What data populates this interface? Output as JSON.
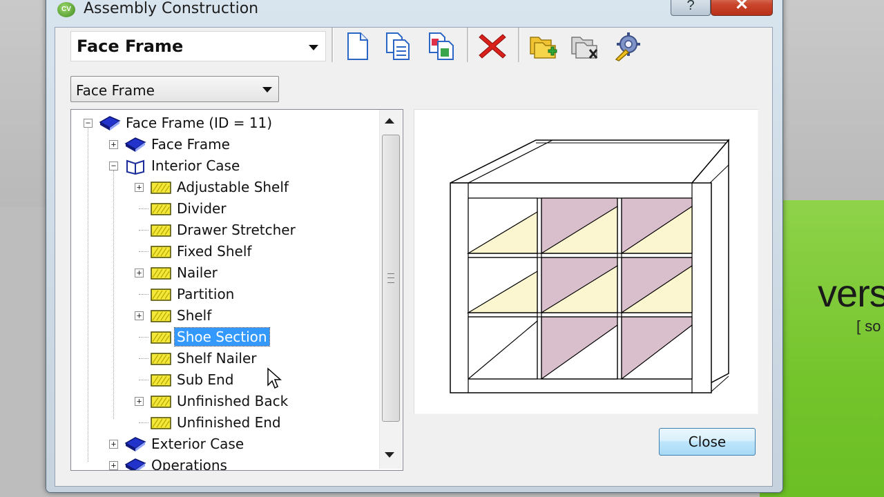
{
  "window": {
    "title": "Assembly Construction",
    "help_glyph": "?",
    "close_glyph": "✕"
  },
  "toolbar": {
    "assembly_combo_value": "Face Frame",
    "icons": [
      "new-page-icon",
      "copy-icon",
      "copy-special-icon",
      "delete-icon",
      "add-folder-icon",
      "remove-folder-icon",
      "settings-gear-icon"
    ]
  },
  "category_combo": {
    "value": "Face Frame"
  },
  "tree": {
    "items": [
      {
        "label": "Face Frame (ID = 11)",
        "icon": "book-icon",
        "expander": "−"
      },
      {
        "label": "Face Frame",
        "icon": "book-icon",
        "expander": "+"
      },
      {
        "label": "Interior Case",
        "icon": "open-book-icon",
        "expander": "−"
      },
      {
        "label": "Adjustable Shelf",
        "icon": "part-icon",
        "expander": "+"
      },
      {
        "label": "Divider",
        "icon": "part-icon",
        "expander": ""
      },
      {
        "label": "Drawer Stretcher",
        "icon": "part-icon",
        "expander": ""
      },
      {
        "label": "Fixed Shelf",
        "icon": "part-icon",
        "expander": ""
      },
      {
        "label": "Nailer",
        "icon": "part-icon",
        "expander": "+"
      },
      {
        "label": "Partition",
        "icon": "part-icon",
        "expander": ""
      },
      {
        "label": "Shelf",
        "icon": "part-icon",
        "expander": "+"
      },
      {
        "label": "Shoe Section",
        "icon": "part-icon",
        "expander": "",
        "selected": true
      },
      {
        "label": "Shelf Nailer",
        "icon": "part-icon",
        "expander": ""
      },
      {
        "label": "Sub End",
        "icon": "part-icon",
        "expander": ""
      },
      {
        "label": "Unfinished Back",
        "icon": "part-icon",
        "expander": "+"
      },
      {
        "label": "Unfinished End",
        "icon": "part-icon",
        "expander": ""
      },
      {
        "label": "Exterior Case",
        "icon": "book-icon",
        "expander": "+"
      },
      {
        "label": "Operations",
        "icon": "book-icon",
        "expander": "+"
      }
    ]
  },
  "buttons": {
    "close_label": "Close"
  },
  "background": {
    "text_right": "vers",
    "text_bracket": "[ so"
  },
  "colors": {
    "selection": "#3399ff",
    "panel_pink": "#d9bfcc",
    "panel_cream": "#fbf6d0",
    "close_x": "#c9452b"
  }
}
